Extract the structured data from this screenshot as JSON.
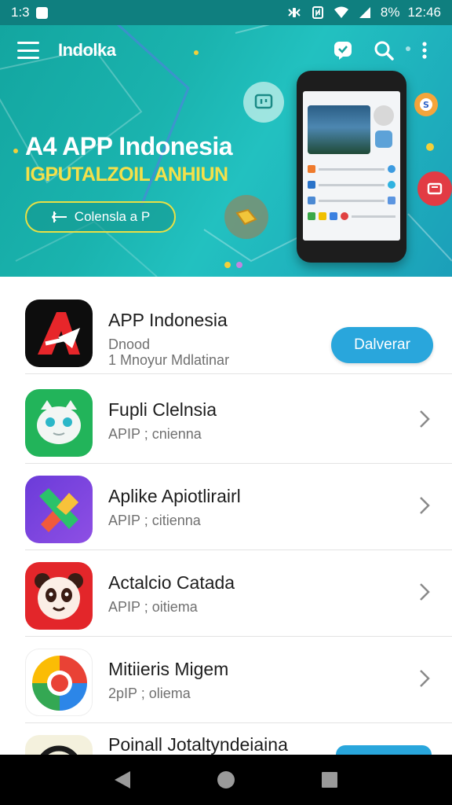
{
  "status_bar": {
    "time_left": "1:3",
    "battery": "8%",
    "time_right": "12:46"
  },
  "app_bar": {
    "title": "Indolka",
    "icons": [
      "menu-icon",
      "chat-icon",
      "search-icon",
      "more-vert-icon"
    ]
  },
  "hero": {
    "title": "A4 APP Indonesia",
    "subtitle": "IGPUTALZOIL ANHIUN",
    "button_label": "Colensla a P",
    "colors": {
      "background": "#1ab3ae",
      "subtitle": "#f4e04a",
      "button_border": "#e8e045"
    }
  },
  "apps": [
    {
      "title": "APP Indonesia",
      "subtitle": "Dnood",
      "subtitle2": "1 Mnoyur Mdlatinar",
      "action": "Dalverar",
      "icon": "app-a-logo-icon"
    },
    {
      "title": "Fupli Clelnsia",
      "subtitle": "APIP ; cnienna",
      "icon": "android-cat-icon"
    },
    {
      "title": "Aplike Apiotlirairl",
      "subtitle": "APIP ; citienna",
      "icon": "x-puzzle-icon"
    },
    {
      "title": "Actalcio Catada",
      "subtitle": "APIP ; oitiema",
      "icon": "panda-icon"
    },
    {
      "title": "Mitiieris Migem",
      "subtitle": "2pIP ; oliema",
      "icon": "chrome-like-icon"
    },
    {
      "title": "Poinall Jotaltyndeiaina",
      "subtitle": "",
      "icon": "circle-app-icon"
    }
  ],
  "nav_bar": {
    "icons": [
      "back-icon",
      "home-icon",
      "recents-icon"
    ]
  },
  "colors": {
    "accent": "#29a6dc",
    "status_bar": "#0f7f7f"
  }
}
